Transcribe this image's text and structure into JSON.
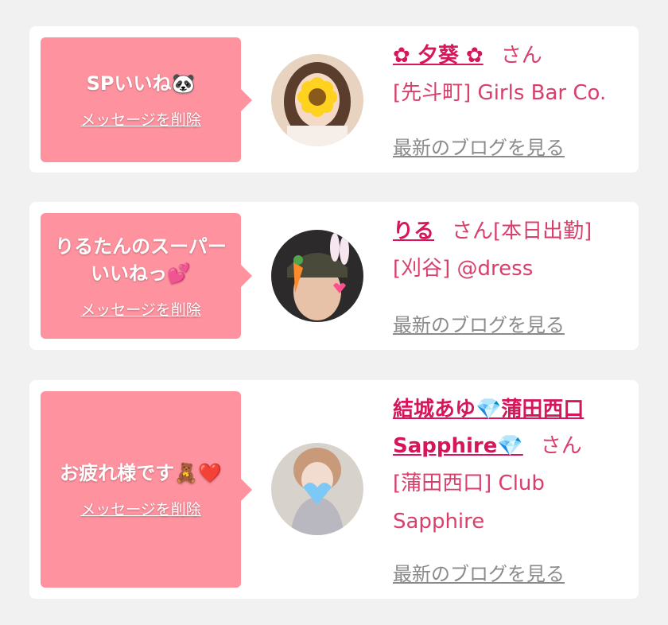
{
  "items": [
    {
      "message": "SPいいね🐼",
      "delete_label": "メッセージを削除",
      "name": "✿ 夕葵 ✿",
      "honorific": "さん",
      "shop": "[先斗町] Girls Bar Co.",
      "blog_link": "最新のブログを見る"
    },
    {
      "message": "りるたんのスーパーいいねっ💕",
      "delete_label": "メッセージを削除",
      "name": "りる",
      "honorific": "さん[本日出勤]",
      "shop": "[刈谷] @dress",
      "blog_link": "最新のブログを見る"
    },
    {
      "message": "お疲れ様です🧸❤️",
      "delete_label": "メッセージを削除",
      "name": "結城あゆ💎蒲田西口Sapphire💎",
      "honorific": "さん",
      "shop": "[蒲田西口] Club Sapphire",
      "blog_link": "最新のブログを見る"
    }
  ],
  "colors": {
    "background": "#f1f1f1",
    "card": "#ffffff",
    "bubble": "#fe929f",
    "name": "#d6155a",
    "text": "#d83f6b",
    "link": "#8b8b8b"
  }
}
